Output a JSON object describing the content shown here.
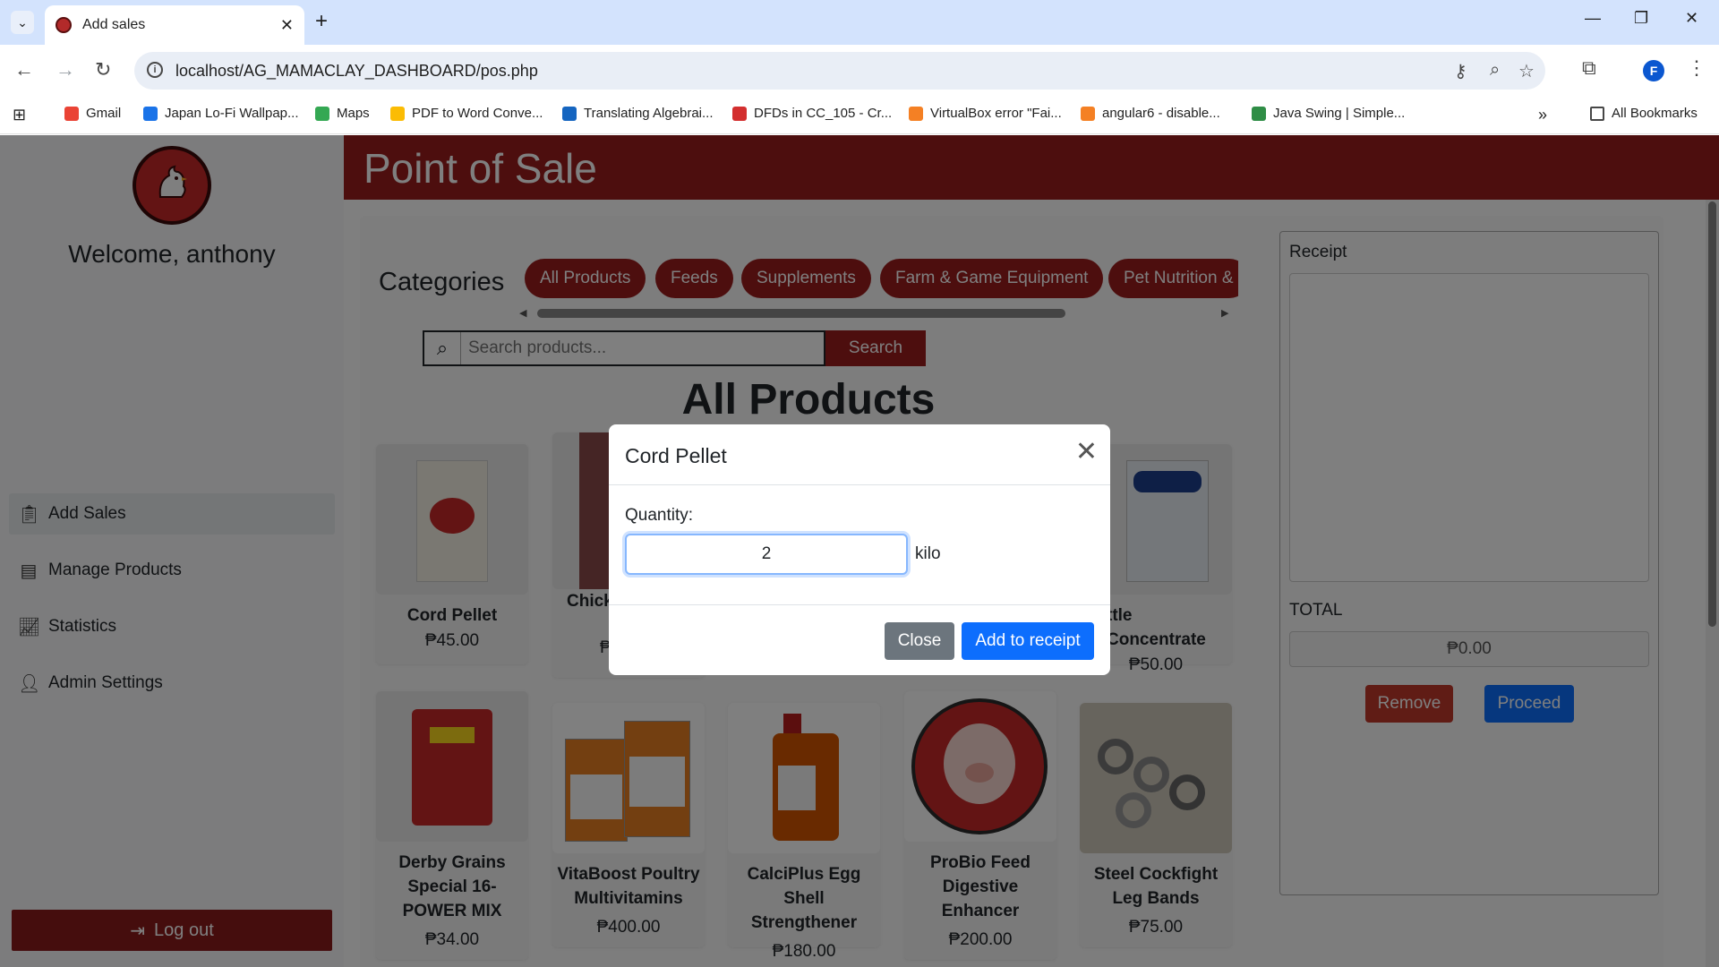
{
  "browser": {
    "tab_title": "Add sales",
    "url": "localhost/AG_MAMACLAY_DASHBOARD/pos.php",
    "profile_initial": "F",
    "bookmarks": [
      {
        "label": "Gmail",
        "icon": "gmail-icon",
        "color": "#ea4335"
      },
      {
        "label": "Japan Lo-Fi Wallpap...",
        "icon": "w-icon",
        "color": "#1a73e8"
      },
      {
        "label": "Maps",
        "icon": "maps-pin-icon",
        "color": "#34a853"
      },
      {
        "label": "PDF to Word Conve...",
        "icon": "pdf-icon",
        "color": "#fbbc04"
      },
      {
        "label": "Translating Algebrai...",
        "icon": "puzzle-icon",
        "color": "#1565c0"
      },
      {
        "label": "DFDs in CC_105 - Cr...",
        "icon": "link-icon",
        "color": "#d32f2f"
      },
      {
        "label": "VirtualBox error \"Fai...",
        "icon": "stack-icon",
        "color": "#f48024"
      },
      {
        "label": "angular6 - disable...",
        "icon": "stack-icon",
        "color": "#f48024"
      },
      {
        "label": "Java Swing | Simple...",
        "icon": "gfg-icon",
        "color": "#2f8d46"
      }
    ],
    "all_bookmarks": "All Bookmarks"
  },
  "sidebar": {
    "welcome": "Welcome, anthony",
    "items": [
      {
        "label": "Add Sales",
        "icon": "clipboard-icon"
      },
      {
        "label": "Manage Products",
        "icon": "list-box-icon"
      },
      {
        "label": "Statistics",
        "icon": "chart-icon"
      },
      {
        "label": "Admin Settings",
        "icon": "user-icon"
      }
    ],
    "logout": "Log out"
  },
  "header": {
    "title": "Point of Sale"
  },
  "categories": {
    "label": "Categories",
    "items": [
      "All Products",
      "Feeds",
      "Supplements",
      "Farm & Game Equipment",
      "Pet Nutrition &"
    ]
  },
  "search": {
    "placeholder": "Search products...",
    "button": "Search"
  },
  "products_title": "All Products",
  "products": [
    {
      "name": "Cord Pellet",
      "price": "₱45.00"
    },
    {
      "name": "Chick",
      "price": "₱"
    },
    {
      "name": "ttle Concentrate",
      "price": "₱50.00"
    },
    {
      "name": "Derby Grains Special 16-POWER MIX",
      "price": "₱34.00"
    },
    {
      "name": "VitaBoost Poultry Multivitamins",
      "price": "₱400.00"
    },
    {
      "name": "CalciPlus Egg Shell Strengthener",
      "price": "₱180.00"
    },
    {
      "name": "ProBio Feed Digestive Enhancer",
      "price": "₱200.00"
    },
    {
      "name": "Steel Cockfight Leg Bands",
      "price": "₱75.00"
    }
  ],
  "receipt": {
    "label": "Receipt",
    "total_label": "TOTAL",
    "total_value": "₱0.00",
    "remove": "Remove",
    "proceed": "Proceed"
  },
  "modal": {
    "title": "Cord Pellet",
    "quantity_label": "Quantity:",
    "quantity_value": "2",
    "unit": "kilo",
    "close": "Close",
    "add": "Add to receipt"
  },
  "colors": {
    "brand": "#9b1c1c",
    "primary": "#0d6efd",
    "secondary": "#6c757d",
    "danger": "#c0392b"
  }
}
